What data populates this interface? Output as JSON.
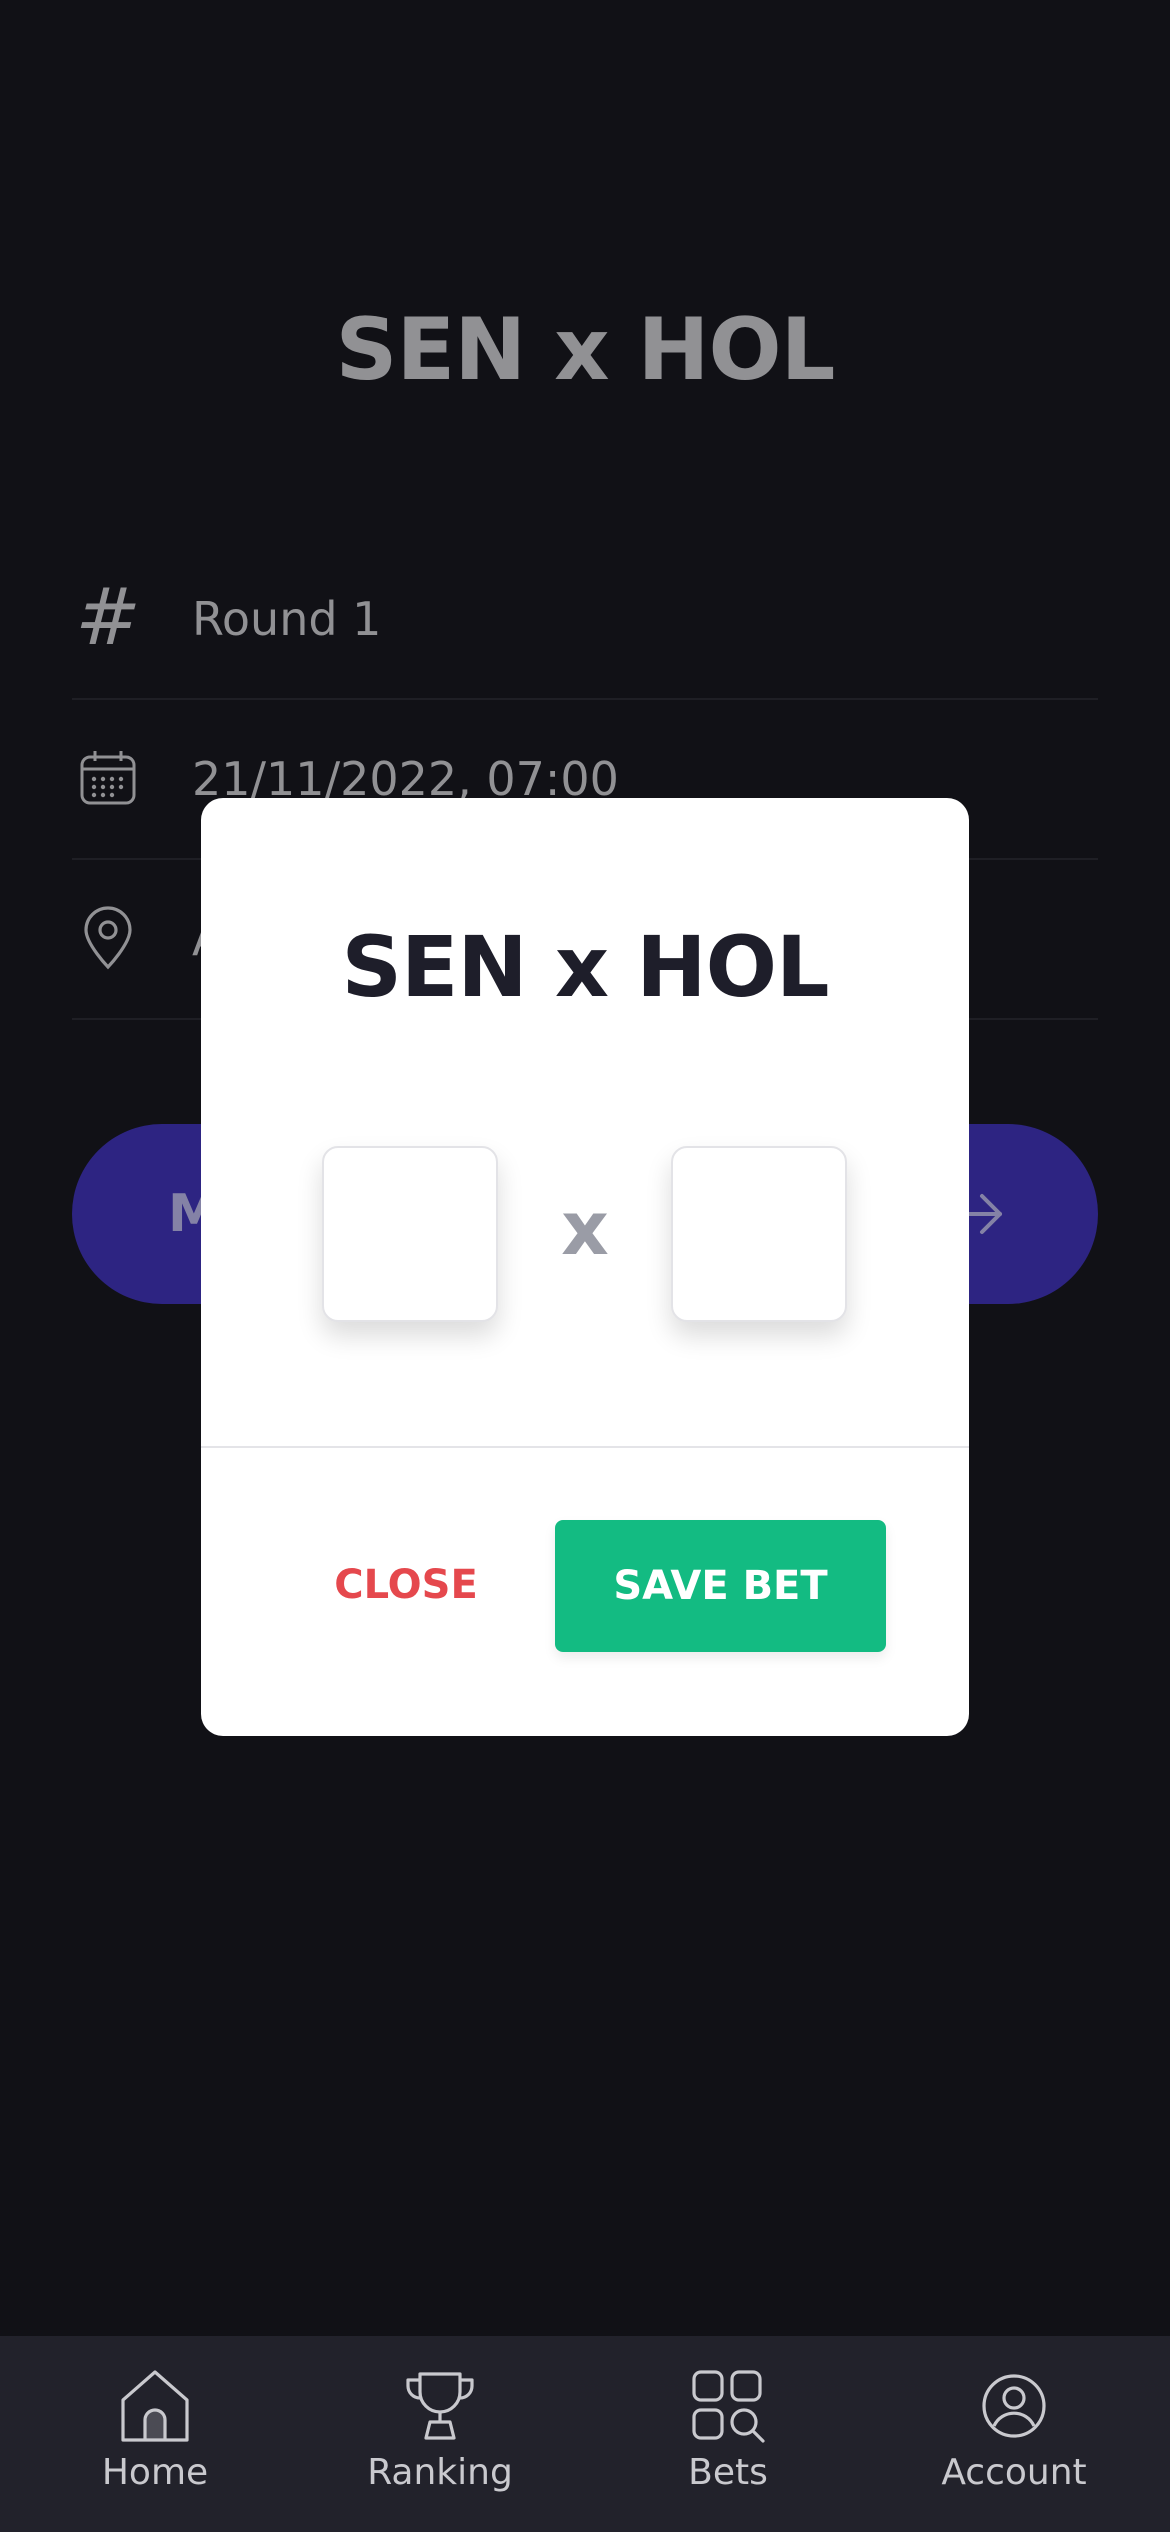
{
  "match": {
    "title": "SEN x HOL"
  },
  "info": {
    "round": "Round 1",
    "datetime": "21/11/2022, 07:00",
    "venue_partial": "A",
    "hash_glyph": "#"
  },
  "action_button": {
    "label_partial": "M"
  },
  "modal": {
    "title": "SEN x HOL",
    "separator": "x",
    "home_score": "",
    "away_score": "",
    "close_label": "CLOSE",
    "save_label": "SAVE BET"
  },
  "nav": {
    "items": [
      {
        "label": "Home",
        "icon": "home-icon"
      },
      {
        "label": "Ranking",
        "icon": "trophy-icon"
      },
      {
        "label": "Bets",
        "icon": "bets-grid-icon"
      },
      {
        "label": "Account",
        "icon": "account-icon"
      }
    ]
  },
  "colors": {
    "background": "#18181f",
    "primary": "#3f33b5",
    "save": "#13bb82",
    "close": "#e5484d"
  }
}
